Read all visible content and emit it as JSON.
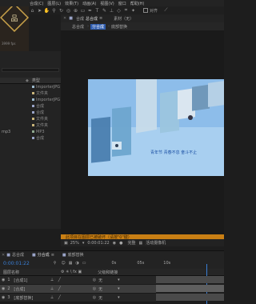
{
  "menu": [
    "合成(C)",
    "图层(L)",
    "效果(T)",
    "动画(A)",
    "视图(V)",
    "窗口",
    "帮助(H)"
  ],
  "toolbar": {
    "snap_label": "对齐"
  },
  "thumb": {
    "caption": "3999 fps"
  },
  "project": {
    "header_type": "类型",
    "items": [
      {
        "name": "",
        "type": "ImporterJPG",
        "color": "#9bb8cc"
      },
      {
        "name": "",
        "type": "文件夹",
        "color": "#c9b47a"
      },
      {
        "name": "",
        "type": "ImporterJPG",
        "color": "#9bb8cc"
      },
      {
        "name": "",
        "type": "合成",
        "color": "#9aa4c8"
      },
      {
        "name": "",
        "type": "合成",
        "color": "#9aa4c8"
      },
      {
        "name": "",
        "type": "文件夹",
        "color": "#c9b47a"
      },
      {
        "name": "",
        "type": "文件夹",
        "color": "#c9b47a"
      },
      {
        "name": "mp3",
        "type": "MP3",
        "color": "#8fa88f"
      },
      {
        "name": "",
        "type": "合成",
        "color": "#9aa4c8"
      }
    ]
  },
  "viewer": {
    "tabs": [
      "合成",
      "总合成",
      "素材（无）"
    ],
    "sub_tabs": [
      "总合成",
      "分合成",
      "底部替换"
    ],
    "canvas_text": "青年节  青春不息  奋斗不止",
    "warning": "此项目在图层已被破坏（请按\"0\"键）",
    "zoom": "25%",
    "time": "0:00:01:22",
    "quality": "完整",
    "camera": "活动摄像机"
  },
  "timeline": {
    "tabs": [
      "总合成",
      "分合成",
      "底部替换"
    ],
    "timecode": "0:00:01:22",
    "col_name": "图层名称",
    "col_parent": "父级和链接",
    "ruler": [
      "0s",
      "05s",
      "10s"
    ],
    "layers": [
      {
        "num": "1",
        "name": "[合成1]",
        "parent": "无",
        "selected": false
      },
      {
        "num": "2",
        "name": "[合成]",
        "parent": "无",
        "selected": true
      },
      {
        "num": "3",
        "name": "[底部替换]",
        "parent": "无",
        "selected": false
      }
    ]
  }
}
